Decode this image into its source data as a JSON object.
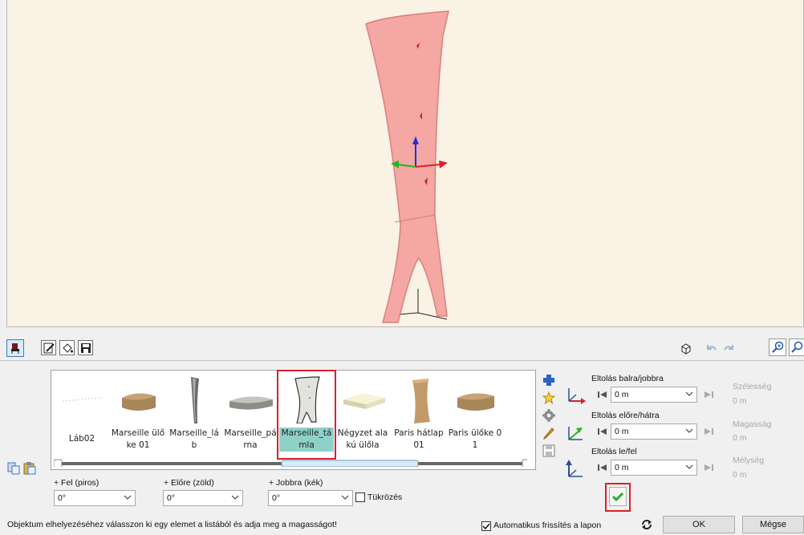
{
  "toolbar": {
    "left_icons": [
      "chair-object-icon",
      "edit-icon",
      "paint-bucket-icon",
      "save-icon"
    ],
    "right_icons": [
      "cube-view-icon",
      "undo-icon",
      "redo-icon",
      "zoom-in-icon",
      "zoom-out-icon"
    ]
  },
  "catalog": {
    "items": [
      {
        "label": "Láb02",
        "selected": false
      },
      {
        "label": "Marseille ülőke 01",
        "selected": false
      },
      {
        "label": "Marseille_láb",
        "selected": false
      },
      {
        "label": "Marseille_párna",
        "selected": false
      },
      {
        "label": "Marseille_támla",
        "selected": true
      },
      {
        "label": "Négyzet alakú ülőla",
        "selected": false
      },
      {
        "label": "Paris hátlap 01",
        "selected": false
      },
      {
        "label": "Paris ülőke 01",
        "selected": false
      }
    ],
    "side_icons": [
      "add-icon",
      "star-icon",
      "gear-icon",
      "pencil-icon",
      "save-icon"
    ]
  },
  "rotation": {
    "up_label": "+ Fel (piros)",
    "up_value": "0°",
    "forward_label": "+ Előre (zöld)",
    "forward_value": "0°",
    "right_label": "+ Jobbra (kék)",
    "right_value": "0°",
    "mirror_label": "Tükrözés"
  },
  "offsets": {
    "lr_label": "Eltolás balra/jobbra",
    "lr_value": "0 m",
    "fb_label": "Eltolás előre/hátra",
    "fb_value": "0 m",
    "ud_label": "Eltolás le/fel",
    "ud_value": "0 m",
    "width_label": "Szélesség",
    "width_value": "0 m",
    "height_label": "Magasság",
    "height_value": "0 m",
    "depth_label": "Mélység",
    "depth_value": "0 m"
  },
  "footer": {
    "hint": "Objektum elhelyezéséhez válasszon ki egy elemet a listából és adja meg a magasságot!",
    "auto_refresh_label": "Automatikus frissítés a lapon",
    "ok_label": "OK",
    "cancel_label": "Mégse"
  },
  "colors": {
    "viewport_bg": "#faf2e4",
    "object_fill": "#f4a3a0",
    "selection_outline": "#d8212b",
    "selected_item_bg": "#8fd1c9"
  }
}
